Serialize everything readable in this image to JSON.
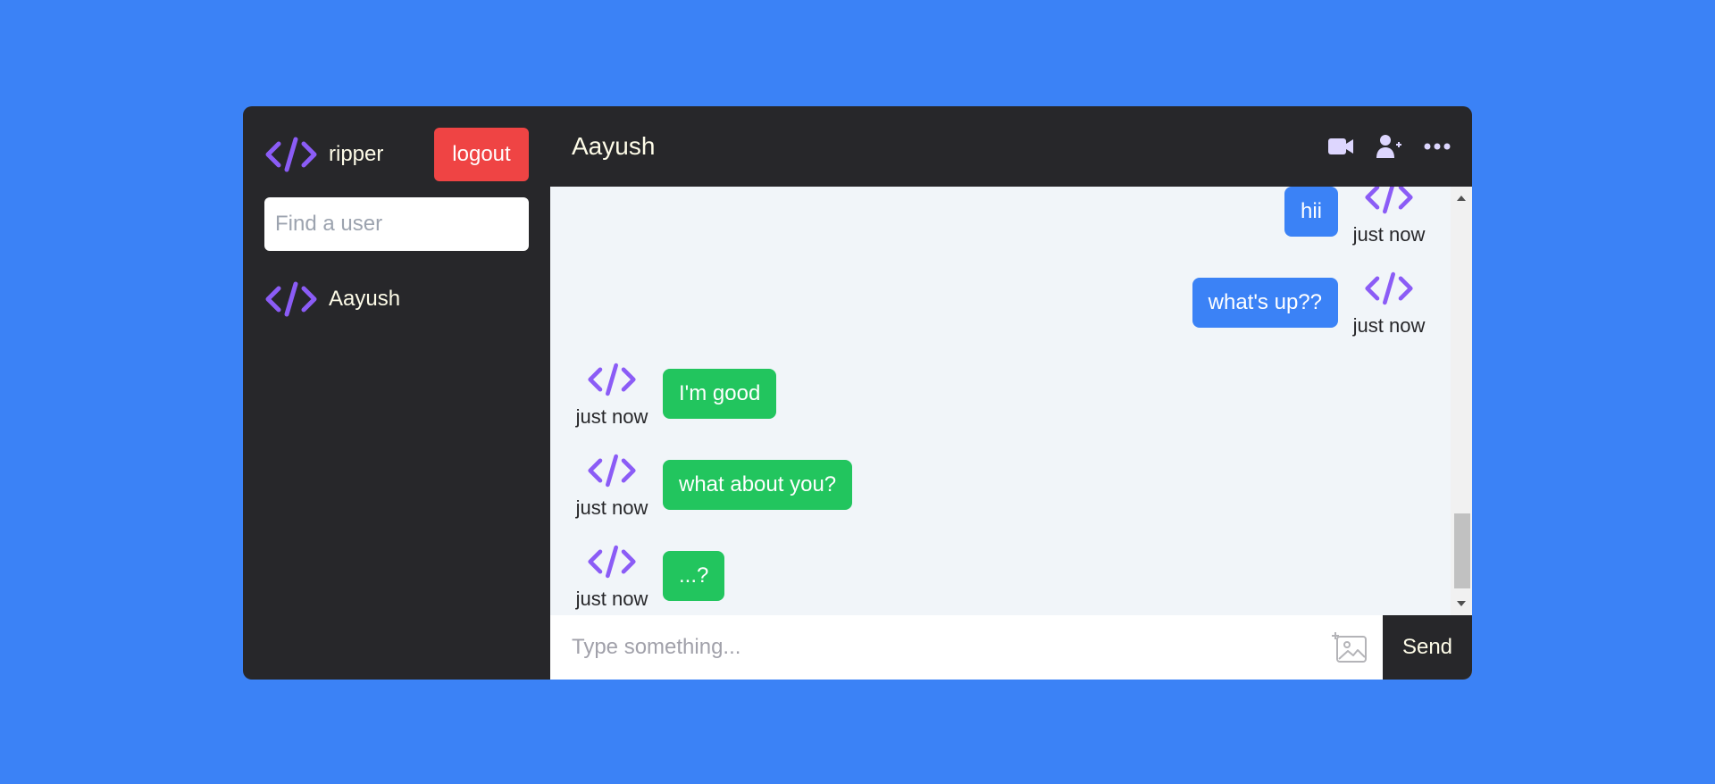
{
  "current_user": {
    "name": "ripper",
    "avatar_icon": "code-icon"
  },
  "sidebar": {
    "logout_label": "logout",
    "search_placeholder": "Find a user",
    "contacts": [
      {
        "name": "Aayush",
        "avatar_icon": "code-icon"
      }
    ]
  },
  "chat": {
    "title": "Aayush",
    "header_icons": [
      "video-camera-icon",
      "add-user-icon",
      "more-options-icon"
    ],
    "messages": [
      {
        "text": "hii",
        "time": "just now",
        "own": true
      },
      {
        "text": "what's up??",
        "time": "just now",
        "own": true
      },
      {
        "text": "I'm good",
        "time": "just now",
        "own": false
      },
      {
        "text": "what about you?",
        "time": "just now",
        "own": false
      },
      {
        "text": "...?",
        "time": "just now",
        "own": false
      }
    ],
    "composer": {
      "placeholder": "Type something...",
      "send_label": "Send",
      "attach_icon": "image-add-icon"
    }
  },
  "colors": {
    "page_background": "#3b82f6",
    "panel": "#27272a",
    "own_bubble": "#3b82f6",
    "other_bubble": "#22c55e",
    "logout": "#ef4444",
    "logo_accent": "#8b5cf6"
  }
}
